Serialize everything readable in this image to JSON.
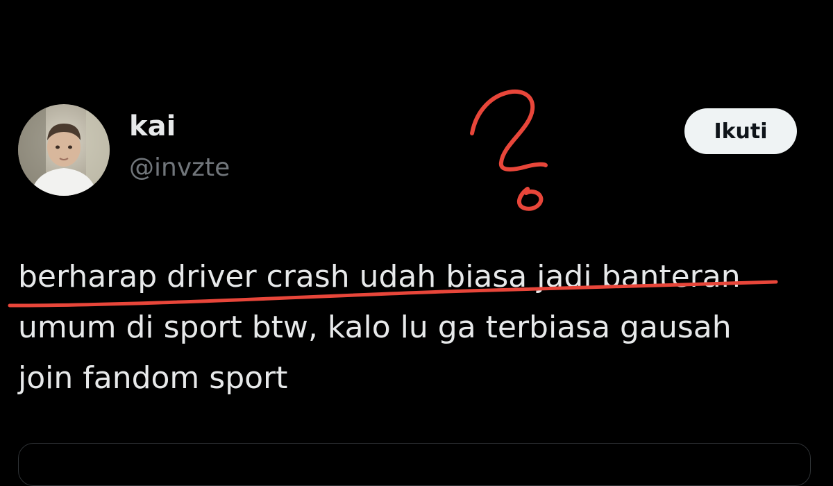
{
  "post": {
    "display_name": "kai",
    "handle": "@invzte",
    "follow_label": "Ikuti",
    "text_lines": [
      "berharap driver crash udah biasa jadi banteran",
      "umum di sport btw, kalo lu ga terbiasa gausah",
      "join fandom sport"
    ]
  },
  "icons": {
    "avatar": "profile-photo",
    "annotation_mark": "question-mark-scribble",
    "annotation_line": "underline-scribble"
  },
  "colors": {
    "background": "#000000",
    "text_primary": "#e7e9ea",
    "text_secondary": "#71767b",
    "button_bg": "#eff3f4",
    "button_text": "#0f1419",
    "annotation": "#e8463a"
  }
}
